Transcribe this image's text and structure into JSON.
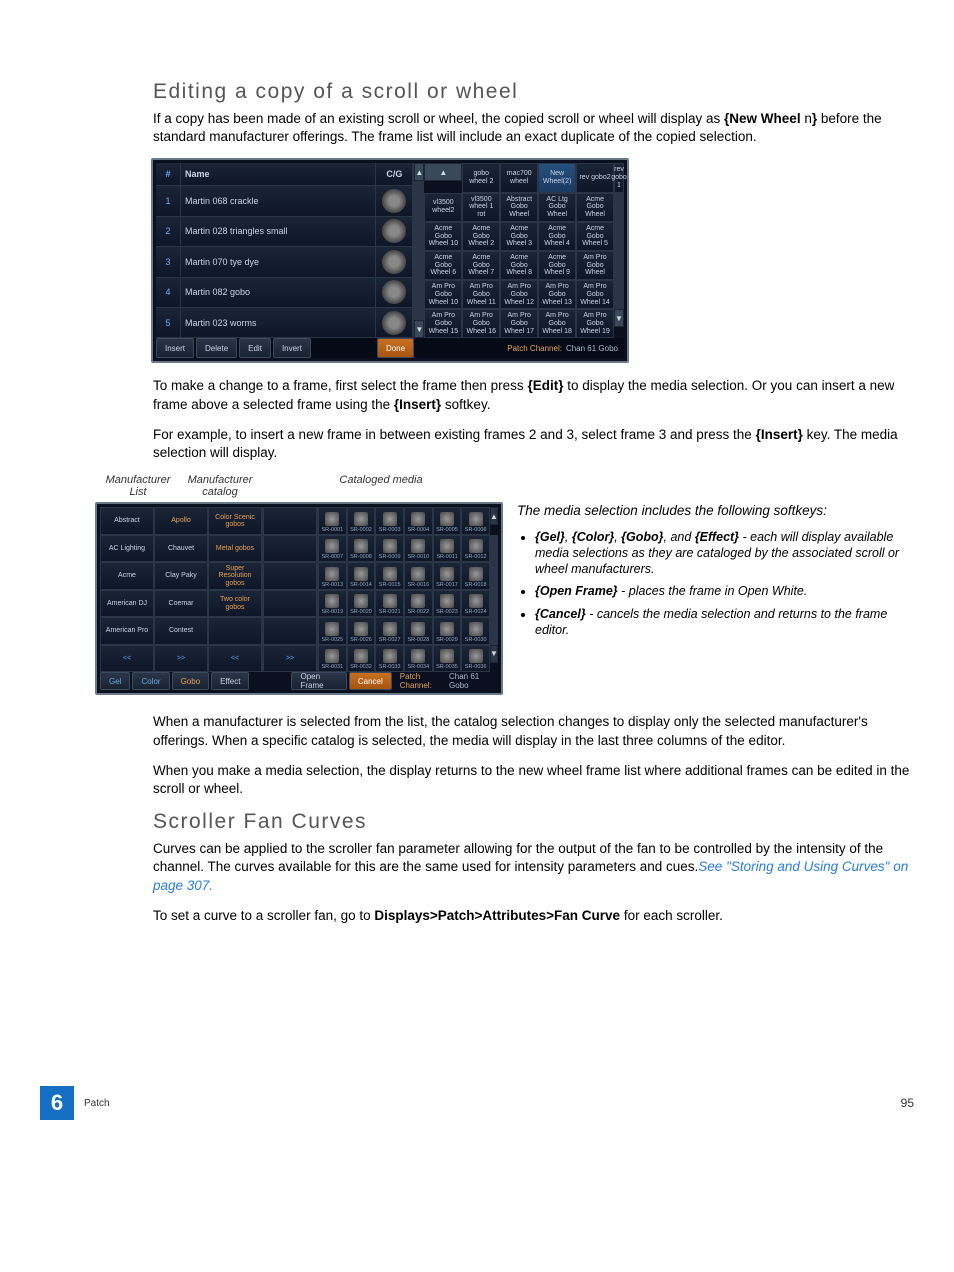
{
  "headings": {
    "editing": "Editing a copy of a scroll or wheel",
    "scroller": "Scroller Fan Curves"
  },
  "para": {
    "p1a": "If a copy has been made of an existing scroll or wheel, the copied scroll or wheel will display as ",
    "p1b": "{New Wheel ",
    "p1c": "n",
    "p1d": "}",
    "p1e": " before the standard manufacturer offerings. The frame list will include an exact duplicate of the copied selection.",
    "p2a": "To make a change to a frame, first select the frame then press ",
    "p2b": "{Edit}",
    "p2c": " to display the media selection. Or you can insert a new frame above a selected frame using the ",
    "p2d": "{Insert}",
    "p2e": " softkey.",
    "p3a": "For example, to insert a new frame in between existing frames 2 and 3, select frame 3 and press the ",
    "p3b": "{Insert}",
    "p3c": " key. The media selection will display.",
    "p4": "When a manufacturer is selected from the list, the catalog selection changes to display only the selected manufacturer's offerings. When a specific catalog is selected, the media will display in the last three columns of the editor.",
    "p5": "When you make a media selection, the display returns to the new wheel frame list where additional frames can be edited in the scroll or wheel.",
    "p6a": "Curves can be applied to the scroller fan parameter allowing for the output of the fan to be controlled by the intensity of the channel. The curves available for this are the same used for intensity parameters and cues.",
    "p6link": "See \"Storing and Using Curves\" on page 307.",
    "p7a": "To set a curve to a scroller fan, go to ",
    "p7b": "Displays>Patch>Attributes>Fan Curve",
    "p7c": " for each scroller."
  },
  "frameEditor": {
    "headers": {
      "num": "#",
      "name": "Name",
      "cg": "C/G"
    },
    "rows": [
      {
        "n": "1",
        "name": "Martin 068 crackle"
      },
      {
        "n": "2",
        "name": "Martin 028 triangles small"
      },
      {
        "n": "3",
        "name": "Martin 070 tye dye"
      },
      {
        "n": "4",
        "name": "Martin 082 gobo"
      },
      {
        "n": "5",
        "name": "Martin 023 worms"
      }
    ],
    "wheelHead": [
      "gobo wheel 2",
      "mac700 wheel",
      "New Wheel(2)",
      "rev gobo2",
      "rev gobo 1"
    ],
    "wheelRows": [
      [
        "vl3500 wheel2",
        "vl3500 wheel 1 rot",
        "Abstract Gobo Wheel",
        "AC Ltg Gobo Wheel",
        "Acme Gobo Wheel"
      ],
      [
        "Acme Gobo Wheel 10",
        "Acme Gobo Wheel 2",
        "Acme Gobo Wheel 3",
        "Acme Gobo Wheel 4",
        "Acme Gobo Wheel 5"
      ],
      [
        "Acme Gobo Wheel 6",
        "Acme Gobo Wheel 7",
        "Acme Gobo Wheel 8",
        "Acme Gobo Wheel 9",
        "Am Pro Gobo Wheel"
      ],
      [
        "Am Pro Gobo Wheel 10",
        "Am Pro Gobo Wheel 11",
        "Am Pro Gobo Wheel 12",
        "Am Pro Gobo Wheel 13",
        "Am Pro Gobo Wheel 14"
      ],
      [
        "Am Pro Gobo Wheel 15",
        "Am Pro Gobo Wheel 16",
        "Am Pro Gobo Wheel 17",
        "Am Pro Gobo Wheel 18",
        "Am Pro Gobo Wheel 19"
      ]
    ],
    "footer": [
      "Insert",
      "Delete",
      "Edit",
      "Invert"
    ],
    "done": "Done",
    "patchLabel": "Patch Channel:",
    "patchValue": "Chan 61 Gobo"
  },
  "mediaSel": {
    "labels": {
      "mlist": "Manufacturer List",
      "mcat": "Manufacturer catalog",
      "media": "Cataloged media"
    },
    "col1": [
      "Abstract",
      "AC Lighting",
      "Acme",
      "American DJ",
      "American Pro",
      "<<"
    ],
    "col2": [
      "Apollo",
      "Chauvet",
      "Clay Paky",
      "Coemar",
      "Contest",
      ">>"
    ],
    "col3": [
      "Color Scenic gobos",
      "Metal gobos",
      "Super Resolution gobos",
      "Two color gobos",
      "",
      "<<"
    ],
    "col4": [
      "",
      "",
      "",
      "",
      "",
      ">>"
    ],
    "mediaIds": [
      "SR-0001",
      "SR-0002",
      "SR-0003",
      "SR-0004",
      "SR-0005",
      "SR-0006",
      "SR-0007",
      "SR-0008",
      "SR-0009",
      "SR-0010",
      "SR-0011",
      "SR-0012",
      "SR-0013",
      "SR-0014",
      "SR-0015",
      "SR-0016",
      "SR-0017",
      "SR-0018",
      "SR-0019",
      "SR-0020",
      "SR-0021",
      "SR-0022",
      "SR-0023",
      "SR-0024",
      "SR-0025",
      "SR-0026",
      "SR-0027",
      "SR-0028",
      "SR-0029",
      "SR-0030",
      "SR-0031",
      "SR-0032",
      "SR-0033",
      "SR-0034",
      "SR-0035",
      "SR-0036"
    ],
    "footer": [
      "Gel",
      "Color",
      "Gobo",
      "Effect"
    ],
    "openFrame": "Open Frame",
    "cancel": "Cancel",
    "patchLabel": "Patch Channel:",
    "patchValue": "Chan 61 Gobo"
  },
  "bullets": {
    "intro": "The media selection includes the following softkeys:",
    "b1a": "{Gel}",
    "b1b": ", ",
    "b1c": "{Color}",
    "b1d": ", ",
    "b1e": "{Gobo}",
    "b1f": ", and ",
    "b1g": "{Effect}",
    "b1h": " - each will display available media selections as they are cataloged by the associated scroll or wheel manufacturers.",
    "b2a": "{Open Frame}",
    "b2b": " - places the frame in Open White.",
    "b3a": "{Cancel}",
    "b3b": " - cancels the media selection and returns to the frame editor."
  },
  "footer": {
    "chapterNum": "6",
    "chapterName": "Patch",
    "pageNum": "95"
  }
}
